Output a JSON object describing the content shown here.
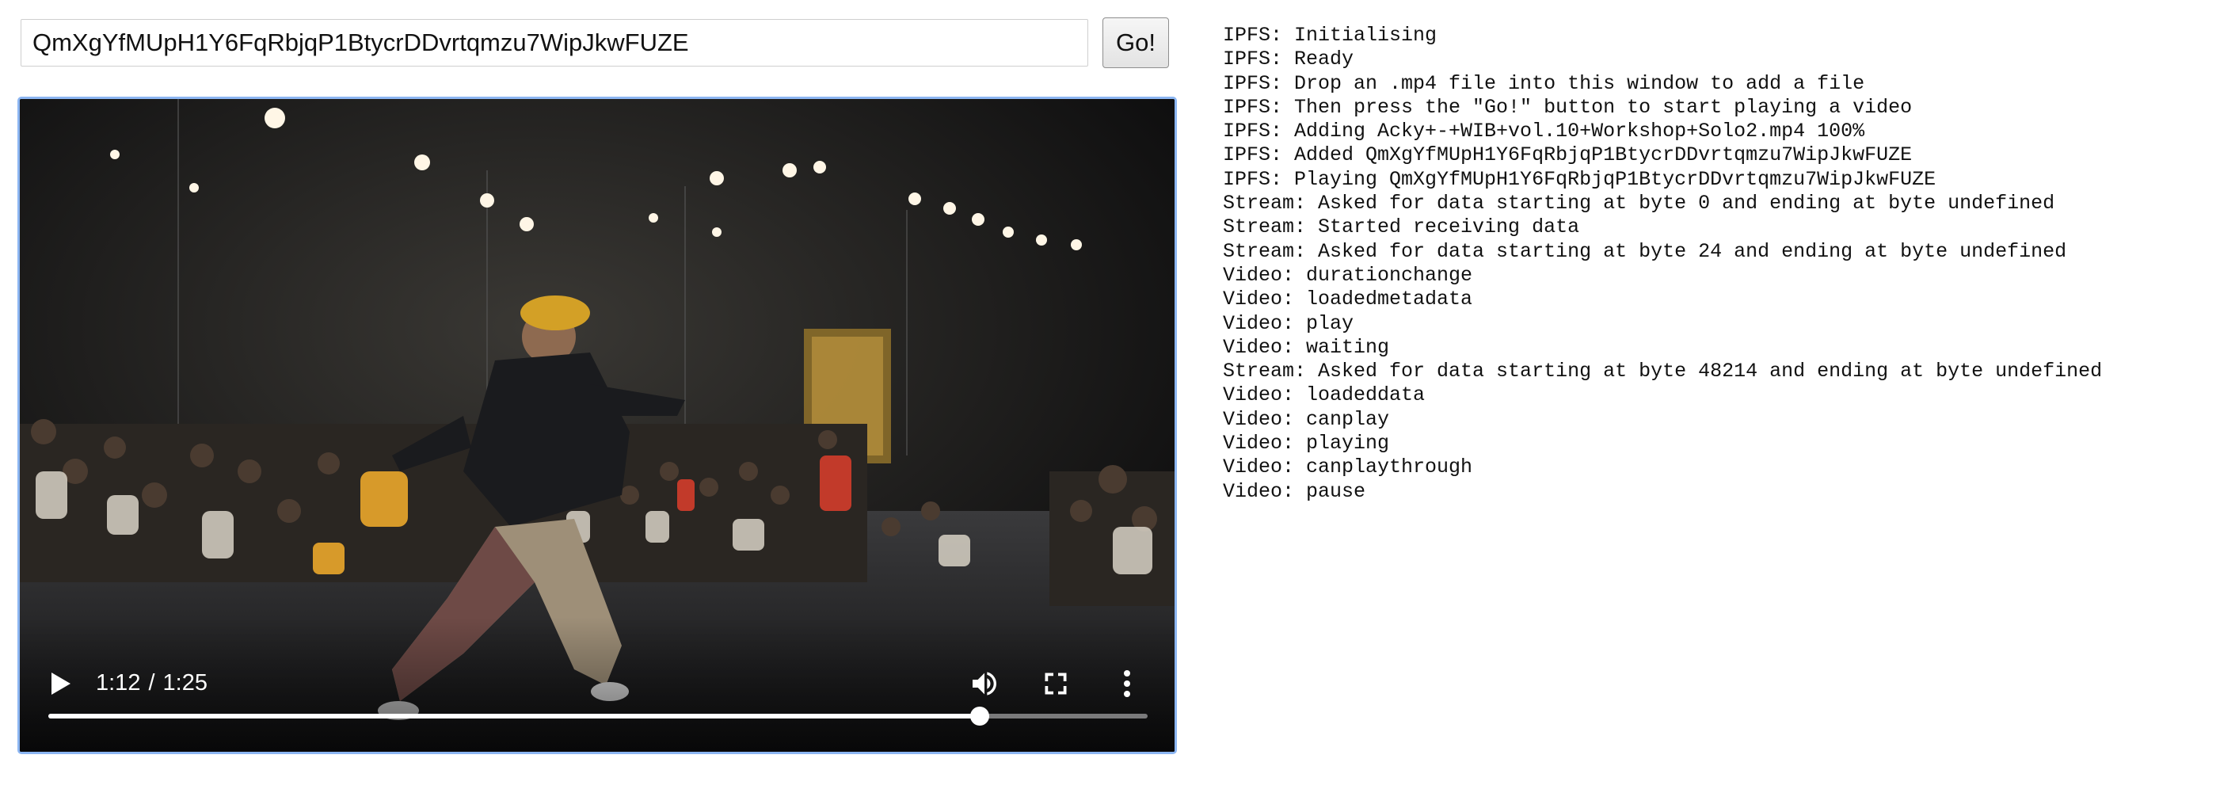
{
  "input": {
    "value": "QmXgYfMUpH1Y6FqRbjqP1BtycrDDvrtqmzu7WipJkwFUZE"
  },
  "go_button": {
    "label": "Go!"
  },
  "video": {
    "current_time": "1:12",
    "separator": "/",
    "duration": "1:25",
    "progress_fraction": 0.847,
    "icons": {
      "play": "play-icon",
      "volume": "volume-icon",
      "fullscreen": "fullscreen-icon",
      "more": "more-vert-icon"
    }
  },
  "log": [
    "IPFS: Initialising",
    "IPFS: Ready",
    "IPFS: Drop an .mp4 file into this window to add a file",
    "IPFS: Then press the \"Go!\" button to start playing a video",
    "IPFS: Adding Acky+-+WIB+vol.10+Workshop+Solo2.mp4 100%",
    "IPFS: Added QmXgYfMUpH1Y6FqRbjqP1BtycrDDvrtqmzu7WipJkwFUZE",
    "IPFS: Playing QmXgYfMUpH1Y6FqRbjqP1BtycrDDvrtqmzu7WipJkwFUZE",
    "Stream: Asked for data starting at byte 0 and ending at byte undefined",
    "Stream: Started receiving data",
    "Stream: Asked for data starting at byte 24 and ending at byte undefined",
    "Video: durationchange",
    "Video: loadedmetadata",
    "Video: play",
    "Video: waiting",
    "Stream: Asked for data starting at byte 48214 and ending at byte undefined",
    "Video: loadeddata",
    "Video: canplay",
    "Video: playing",
    "Video: canplaythrough",
    "Video: pause"
  ]
}
